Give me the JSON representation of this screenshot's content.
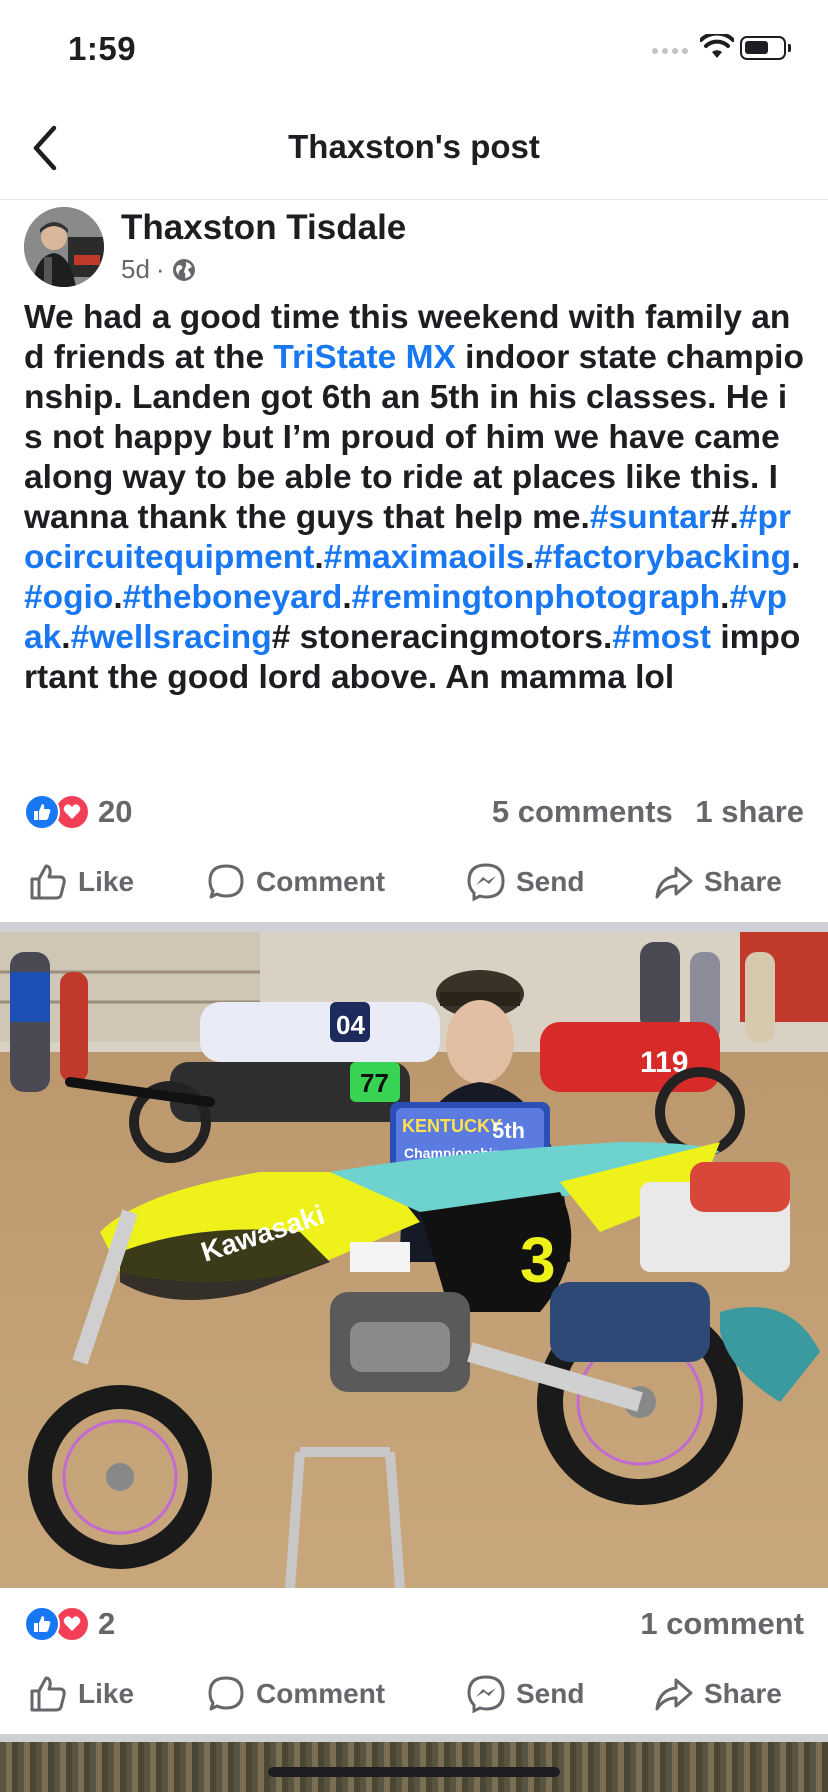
{
  "status": {
    "time": "1:59"
  },
  "header": {
    "title": "Thaxston's post"
  },
  "post": {
    "author": "Thaxston Tisdale",
    "age": "5d",
    "text_segments": [
      {
        "t": "We had a good time this weekend with family and friends at the ",
        "link": false
      },
      {
        "t": "TriState MX",
        "link": true
      },
      {
        "t": " indoor  state championship. Landen got 6th an 5th in his classes. He is not happy but I’m proud of him we have came along way to be able to ride at places like this. I wanna thank the guys that help me.",
        "link": false
      },
      {
        "t": "#suntar",
        "link": true
      },
      {
        "t": "#.",
        "link": false
      },
      {
        "t": "#procircuitequipment",
        "link": true
      },
      {
        "t": ".",
        "link": false
      },
      {
        "t": "#maximaoils",
        "link": true
      },
      {
        "t": ".",
        "link": false
      },
      {
        "t": "#factorybacking",
        "link": true
      },
      {
        "t": ".",
        "link": false
      },
      {
        "t": "#ogio",
        "link": true
      },
      {
        "t": ".",
        "link": false
      },
      {
        "t": "#theboneyard",
        "link": true
      },
      {
        "t": ".",
        "link": false
      },
      {
        "t": "#remingtonphotograph",
        "link": true
      },
      {
        "t": ".",
        "link": false
      },
      {
        "t": "#vpak",
        "link": true
      },
      {
        "t": ".",
        "link": false
      },
      {
        "t": "#wellsracing",
        "link": true
      },
      {
        "t": "# stoneracingmotors.",
        "link": false
      },
      {
        "t": "#most",
        "link": true
      },
      {
        "t": " important the good lord above. An mamma lol",
        "link": false
      }
    ],
    "reaction_count": "20",
    "comments": "5 comments",
    "shares": "1 share"
  },
  "actions": {
    "like": "Like",
    "comment": "Comment",
    "send": "Send",
    "share": "Share"
  },
  "photo": {
    "trophy_title": "KENTUCKY",
    "trophy_place": "5th",
    "trophy_sub": "Championship",
    "bike_number": "3",
    "bike_brand": "Kawasaki",
    "bg_number_1": "04",
    "bg_number_2": "77",
    "bg_number_3": "119",
    "reaction_count": "2",
    "comments": "1 comment"
  },
  "colors": {
    "link": "#1877f2",
    "muted": "#65676b",
    "like_blue": "#1877f2",
    "love_red": "#f33e58"
  }
}
